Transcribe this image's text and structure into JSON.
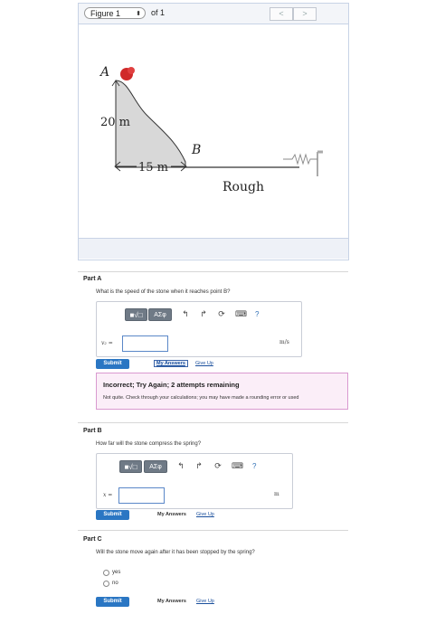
{
  "figure": {
    "selector_label": "Figure 1",
    "selector_arrows": "⬍",
    "of_label": "of 1",
    "prev_glyph": "<",
    "next_glyph": ">",
    "diagram": {
      "point_a": "A",
      "point_b": "B",
      "height_label": "20 m",
      "width_label": "15 m",
      "surface_label": "Rough"
    }
  },
  "toolbar_items": {
    "templates": "■√□",
    "greek": "AΣφ",
    "undo": "↰",
    "redo": "↱",
    "reset": "⟳",
    "keyboard": "⌨",
    "help": "?"
  },
  "part_a": {
    "title": "Part A",
    "question": "What is the speed of the stone when it reaches point B?",
    "variable": "v₂ =",
    "unit": "m/s",
    "submit": "Submit",
    "my_answers": "My Answers",
    "give_up": "Give Up",
    "feedback_title": "Incorrect; Try Again; 2 attempts remaining",
    "feedback_text": "Not quite. Check through your calculations; you may have made a rounding error or used"
  },
  "part_b": {
    "title": "Part B",
    "question": "How far will the stone compress the spring?",
    "variable": "x =",
    "unit": "m",
    "submit": "Submit",
    "my_answers": "My Answers",
    "give_up": "Give Up"
  },
  "part_c": {
    "title": "Part C",
    "question": "Will the stone move again after it has been stopped by the spring?",
    "options": [
      "yes",
      "no"
    ],
    "submit": "Submit",
    "my_answers": "My Answers",
    "give_up": "Give Up"
  }
}
